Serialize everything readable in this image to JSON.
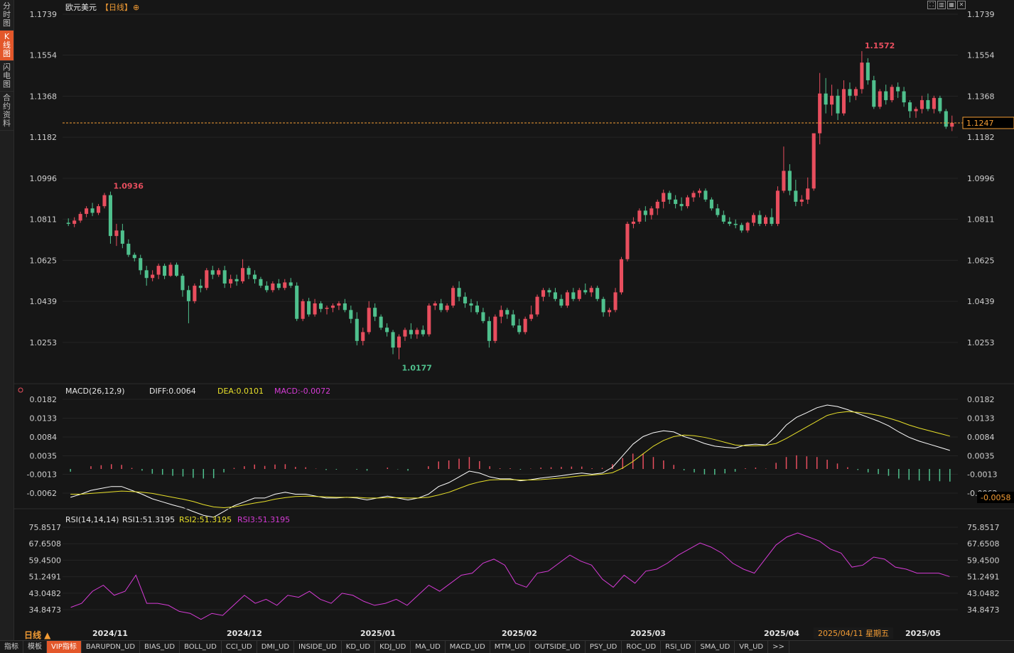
{
  "sidebar": [
    {
      "label": "分时图",
      "active": false
    },
    {
      "label": "K线图",
      "active": true
    },
    {
      "label": "闪电图",
      "active": false
    },
    {
      "label": "合约资料",
      "active": false
    }
  ],
  "header": {
    "symbol": "欧元美元",
    "period": "【日线】",
    "plus_icon": "⊕"
  },
  "toolbar_icons": [
    "fullscreen-icon",
    "layout-icon",
    "split-icon",
    "close-icon"
  ],
  "price_panel": {
    "ticks": [
      "1.1739",
      "1.1554",
      "1.1368",
      "1.1182",
      "1.0996",
      "1.0811",
      "1.0625",
      "1.0439",
      "1.0253"
    ],
    "current_price": "1.1247",
    "high_label": "1.1572",
    "high2_label": "1.0936",
    "low_label": "1.0177"
  },
  "macd_panel": {
    "title": "MACD(26,12,9)",
    "diff": "DIFF:0.0064",
    "dea": "DEA:0.0101",
    "macd": "MACD:-0.0072",
    "ticks": [
      "0.0182",
      "0.0133",
      "0.0084",
      "0.0035",
      "-0.0013",
      "-0.0062"
    ],
    "current": "-0.0058"
  },
  "rsi_panel": {
    "title": "RSI(14,14,14)",
    "rsi1": "RSI1:51.3195",
    "rsi2": "RSI2:51.3195",
    "rsi3": "RSI3:51.3195",
    "ticks": [
      "75.8517",
      "67.6508",
      "59.4500",
      "51.2491",
      "43.0482",
      "34.8473"
    ]
  },
  "x_axis": {
    "period_label": "日线 ▲",
    "labels": [
      "2024/11",
      "2024/12",
      "2025/01",
      "2025/02",
      "2025/03",
      "2025/04",
      "2025/05"
    ],
    "cursor_label": "2025/04/11 星期五"
  },
  "colors": {
    "up": "#e84e5e",
    "down": "#4fc08d",
    "diff": "#ffffff",
    "dea": "#e8e02a",
    "macd": "#d63bd6",
    "rsi": "#d63bd6",
    "current": "#f39c34"
  },
  "bottom_tabs": [
    "指标",
    "模板",
    "VIP指标",
    "BARUPDN_UD",
    "BIAS_UD",
    "BOLL_UD",
    "CCI_UD",
    "DMI_UD",
    "INSIDE_UD",
    "KD_UD",
    "KDJ_UD",
    "MA_UD",
    "MACD_UD",
    "MTM_UD",
    "OUTSIDE_UD",
    "PSY_UD",
    "ROC_UD",
    "RSI_UD",
    "SMA_UD",
    "VR_UD",
    ">>"
  ],
  "chart_data": {
    "type": "candlestick",
    "title": "欧元美元",
    "ylim": [
      1.012,
      1.18
    ],
    "ohlc": [
      [
        1.0795,
        1.0815,
        1.078,
        1.079
      ],
      [
        1.079,
        1.082,
        1.0775,
        1.0805
      ],
      [
        1.0805,
        1.0845,
        1.0795,
        1.0835
      ],
      [
        1.0835,
        1.087,
        1.082,
        1.086
      ],
      [
        1.086,
        1.0885,
        1.0825,
        1.084
      ],
      [
        1.084,
        1.088,
        1.083,
        1.087
      ],
      [
        1.087,
        1.093,
        1.086,
        1.092
      ],
      [
        1.092,
        1.0936,
        1.07,
        1.0735
      ],
      [
        1.0735,
        1.079,
        1.069,
        1.076
      ],
      [
        1.076,
        1.079,
        1.068,
        1.07
      ],
      [
        1.07,
        1.072,
        1.064,
        1.065
      ],
      [
        1.065,
        1.066,
        1.062,
        1.0635
      ],
      [
        1.0635,
        1.065,
        1.056,
        1.058
      ],
      [
        1.058,
        1.06,
        1.051,
        1.0545
      ],
      [
        1.0545,
        1.058,
        1.053,
        1.056
      ],
      [
        1.056,
        1.061,
        1.054,
        1.06
      ],
      [
        1.06,
        1.061,
        1.054,
        1.0555
      ],
      [
        1.0555,
        1.0615,
        1.055,
        1.0605
      ],
      [
        1.0605,
        1.0615,
        1.055,
        1.0555
      ],
      [
        1.0555,
        1.0565,
        1.046,
        1.049
      ],
      [
        1.049,
        1.051,
        1.034,
        1.044
      ],
      [
        1.044,
        1.052,
        1.043,
        1.051
      ],
      [
        1.051,
        1.054,
        1.048,
        1.05
      ],
      [
        1.05,
        1.059,
        1.049,
        1.058
      ],
      [
        1.058,
        1.06,
        1.054,
        1.056
      ],
      [
        1.056,
        1.059,
        1.055,
        1.058
      ],
      [
        1.058,
        1.06,
        1.05,
        1.052
      ],
      [
        1.052,
        1.056,
        1.05,
        1.054
      ],
      [
        1.054,
        1.056,
        1.051,
        1.053
      ],
      [
        1.053,
        1.063,
        1.052,
        1.059
      ],
      [
        1.059,
        1.06,
        1.054,
        1.056
      ],
      [
        1.056,
        1.058,
        1.052,
        1.054
      ],
      [
        1.054,
        1.055,
        1.05,
        1.051
      ],
      [
        1.051,
        1.053,
        1.048,
        1.049
      ],
      [
        1.049,
        1.053,
        1.048,
        1.052
      ],
      [
        1.052,
        1.054,
        1.049,
        1.05
      ],
      [
        1.05,
        1.054,
        1.049,
        1.0525
      ],
      [
        1.0525,
        1.0545,
        1.05,
        1.051
      ],
      [
        1.051,
        1.0525,
        1.035,
        1.036
      ],
      [
        1.036,
        1.045,
        1.035,
        1.044
      ],
      [
        1.044,
        1.0455,
        1.037,
        1.038
      ],
      [
        1.038,
        1.045,
        1.037,
        1.043
      ],
      [
        1.043,
        1.044,
        1.039,
        1.0405
      ],
      [
        1.0405,
        1.042,
        1.038,
        1.041
      ],
      [
        1.041,
        1.043,
        1.039,
        1.042
      ],
      [
        1.042,
        1.044,
        1.04,
        1.043
      ],
      [
        1.043,
        1.045,
        1.039,
        1.04
      ],
      [
        1.04,
        1.042,
        1.034,
        1.036
      ],
      [
        1.036,
        1.039,
        1.024,
        1.026
      ],
      [
        1.026,
        1.032,
        1.024,
        1.03
      ],
      [
        1.03,
        1.044,
        1.029,
        1.041
      ],
      [
        1.041,
        1.043,
        1.035,
        1.037
      ],
      [
        1.037,
        1.038,
        1.031,
        1.032
      ],
      [
        1.032,
        1.034,
        1.028,
        1.03
      ],
      [
        1.03,
        1.031,
        1.02,
        1.023
      ],
      [
        1.023,
        1.029,
        1.0177,
        1.028
      ],
      [
        1.028,
        1.032,
        1.026,
        1.031
      ],
      [
        1.031,
        1.034,
        1.027,
        1.029
      ],
      [
        1.029,
        1.032,
        1.027,
        1.031
      ],
      [
        1.031,
        1.033,
        1.028,
        1.029
      ],
      [
        1.029,
        1.043,
        1.028,
        1.042
      ],
      [
        1.042,
        1.044,
        1.04,
        1.043
      ],
      [
        1.043,
        1.045,
        1.039,
        1.04
      ],
      [
        1.04,
        1.043,
        1.039,
        1.042
      ],
      [
        1.042,
        1.051,
        1.041,
        1.05
      ],
      [
        1.05,
        1.053,
        1.044,
        1.046
      ],
      [
        1.046,
        1.048,
        1.041,
        1.043
      ],
      [
        1.043,
        1.045,
        1.039,
        1.042
      ],
      [
        1.042,
        1.044,
        1.038,
        1.039
      ],
      [
        1.039,
        1.041,
        1.034,
        1.035
      ],
      [
        1.035,
        1.037,
        1.023,
        1.026
      ],
      [
        1.026,
        1.038,
        1.025,
        1.037
      ],
      [
        1.037,
        1.042,
        1.034,
        1.04
      ],
      [
        1.04,
        1.041,
        1.036,
        1.038
      ],
      [
        1.038,
        1.04,
        1.032,
        1.033
      ],
      [
        1.033,
        1.036,
        1.029,
        1.03
      ],
      [
        1.03,
        1.037,
        1.029,
        1.036
      ],
      [
        1.036,
        1.042,
        1.035,
        1.038
      ],
      [
        1.038,
        1.047,
        1.037,
        1.046
      ],
      [
        1.046,
        1.05,
        1.044,
        1.049
      ],
      [
        1.049,
        1.05,
        1.046,
        1.048
      ],
      [
        1.048,
        1.05,
        1.044,
        1.045
      ],
      [
        1.045,
        1.047,
        1.041,
        1.042
      ],
      [
        1.042,
        1.049,
        1.041,
        1.048
      ],
      [
        1.048,
        1.05,
        1.044,
        1.045
      ],
      [
        1.045,
        1.05,
        1.044,
        1.049
      ],
      [
        1.049,
        1.052,
        1.047,
        1.048
      ],
      [
        1.048,
        1.051,
        1.046,
        1.05
      ],
      [
        1.05,
        1.051,
        1.044,
        1.045
      ],
      [
        1.045,
        1.046,
        1.037,
        1.039
      ],
      [
        1.039,
        1.041,
        1.037,
        1.04
      ],
      [
        1.04,
        1.05,
        1.039,
        1.048
      ],
      [
        1.048,
        1.064,
        1.047,
        1.063
      ],
      [
        1.063,
        1.08,
        1.062,
        1.079
      ],
      [
        1.079,
        1.082,
        1.077,
        1.08
      ],
      [
        1.08,
        1.086,
        1.079,
        1.085
      ],
      [
        1.085,
        1.087,
        1.08,
        1.083
      ],
      [
        1.083,
        1.087,
        1.081,
        1.086
      ],
      [
        1.086,
        1.09,
        1.083,
        1.089
      ],
      [
        1.089,
        1.0945,
        1.086,
        1.093
      ],
      [
        1.093,
        1.094,
        1.088,
        1.09
      ],
      [
        1.09,
        1.092,
        1.086,
        1.088
      ],
      [
        1.088,
        1.091,
        1.085,
        1.087
      ],
      [
        1.087,
        1.092,
        1.086,
        1.091
      ],
      [
        1.091,
        1.094,
        1.089,
        1.093
      ],
      [
        1.093,
        1.095,
        1.091,
        1.094
      ],
      [
        1.094,
        1.095,
        1.089,
        1.09
      ],
      [
        1.09,
        1.091,
        1.085,
        1.086
      ],
      [
        1.086,
        1.088,
        1.082,
        1.083
      ],
      [
        1.083,
        1.085,
        1.079,
        1.08
      ],
      [
        1.08,
        1.082,
        1.078,
        1.079
      ],
      [
        1.079,
        1.081,
        1.077,
        1.0785
      ],
      [
        1.0785,
        1.0795,
        1.075,
        1.076
      ],
      [
        1.076,
        1.08,
        1.075,
        1.0795
      ],
      [
        1.0795,
        1.084,
        1.078,
        1.083
      ],
      [
        1.083,
        1.085,
        1.078,
        1.079
      ],
      [
        1.079,
        1.083,
        1.078,
        1.082
      ],
      [
        1.082,
        1.086,
        1.078,
        1.079
      ],
      [
        1.079,
        1.096,
        1.078,
        1.094
      ],
      [
        1.094,
        1.114,
        1.093,
        1.103
      ],
      [
        1.103,
        1.106,
        1.092,
        1.094
      ],
      [
        1.094,
        1.099,
        1.087,
        1.089
      ],
      [
        1.089,
        1.092,
        1.087,
        1.09
      ],
      [
        1.09,
        1.1,
        1.088,
        1.095
      ],
      [
        1.095,
        1.114,
        1.094,
        1.12
      ],
      [
        1.12,
        1.1473,
        1.115,
        1.138
      ],
      [
        1.138,
        1.145,
        1.129,
        1.133
      ],
      [
        1.133,
        1.142,
        1.128,
        1.137
      ],
      [
        1.137,
        1.14,
        1.126,
        1.129
      ],
      [
        1.129,
        1.144,
        1.128,
        1.14
      ],
      [
        1.14,
        1.143,
        1.134,
        1.137
      ],
      [
        1.137,
        1.141,
        1.135,
        1.14
      ],
      [
        1.14,
        1.1572,
        1.138,
        1.152
      ],
      [
        1.152,
        1.154,
        1.142,
        1.144
      ],
      [
        1.144,
        1.146,
        1.131,
        1.132
      ],
      [
        1.132,
        1.14,
        1.131,
        1.139
      ],
      [
        1.139,
        1.142,
        1.133,
        1.135
      ],
      [
        1.135,
        1.142,
        1.134,
        1.141
      ],
      [
        1.141,
        1.143,
        1.136,
        1.139
      ],
      [
        1.139,
        1.141,
        1.132,
        1.134
      ],
      [
        1.134,
        1.135,
        1.127,
        1.13
      ],
      [
        1.13,
        1.132,
        1.127,
        1.131
      ],
      [
        1.131,
        1.137,
        1.129,
        1.135
      ],
      [
        1.135,
        1.138,
        1.13,
        1.131
      ],
      [
        1.131,
        1.137,
        1.129,
        1.136
      ],
      [
        1.136,
        1.137,
        1.129,
        1.13
      ],
      [
        1.13,
        1.131,
        1.122,
        1.123
      ],
      [
        1.123,
        1.128,
        1.121,
        1.1247
      ]
    ],
    "macd": {
      "diff": [
        -0.0058,
        -0.005,
        -0.004,
        -0.0035,
        -0.003,
        -0.003,
        -0.004,
        -0.005,
        -0.0062,
        -0.007,
        -0.0078,
        -0.0085,
        -0.0095,
        -0.0105,
        -0.011,
        -0.0095,
        -0.008,
        -0.007,
        -0.006,
        -0.006,
        -0.005,
        -0.0045,
        -0.005,
        -0.005,
        -0.0055,
        -0.006,
        -0.006,
        -0.0058,
        -0.006,
        -0.0065,
        -0.006,
        -0.0055,
        -0.006,
        -0.0065,
        -0.006,
        -0.005,
        -0.003,
        -0.002,
        -0.0005,
        0.001,
        0.0005,
        -0.0005,
        -0.001,
        -0.001,
        -0.0015,
        -0.0012,
        -0.0008,
        -0.0005,
        -0.0002,
        0.0002,
        0.0005,
        0.0002,
        0.0005,
        0.002,
        0.005,
        0.008,
        0.01,
        0.011,
        0.0115,
        0.0112,
        0.01,
        0.0092,
        0.0082,
        0.0075,
        0.0072,
        0.007,
        0.0078,
        0.008,
        0.0078,
        0.01,
        0.013,
        0.015,
        0.0162,
        0.0175,
        0.0182,
        0.0178,
        0.017,
        0.016,
        0.015,
        0.014,
        0.0128,
        0.0112,
        0.0098,
        0.0088,
        0.008,
        0.0072,
        0.0064
      ],
      "dea": [
        -0.005,
        -0.005,
        -0.0048,
        -0.0046,
        -0.0044,
        -0.0042,
        -0.0043,
        -0.0045,
        -0.0048,
        -0.0053,
        -0.0058,
        -0.0063,
        -0.0069,
        -0.0077,
        -0.0083,
        -0.0085,
        -0.0083,
        -0.0078,
        -0.0073,
        -0.0069,
        -0.0063,
        -0.0059,
        -0.0056,
        -0.0055,
        -0.0056,
        -0.0057,
        -0.0058,
        -0.0058,
        -0.0058,
        -0.006,
        -0.006,
        -0.0059,
        -0.0059,
        -0.006,
        -0.006,
        -0.0058,
        -0.0052,
        -0.0045,
        -0.0035,
        -0.0025,
        -0.0018,
        -0.0013,
        -0.0012,
        -0.0012,
        -0.0013,
        -0.0013,
        -0.0012,
        -0.001,
        -0.0008,
        -0.0005,
        -0.0002,
        0.0,
        0.0002,
        0.0006,
        0.0018,
        0.0035,
        0.0055,
        0.0075,
        0.009,
        0.01,
        0.0104,
        0.0102,
        0.0098,
        0.0092,
        0.0085,
        0.0078,
        0.0076,
        0.0076,
        0.0077,
        0.0082,
        0.0095,
        0.011,
        0.0125,
        0.014,
        0.0155,
        0.0162,
        0.0165,
        0.0163,
        0.016,
        0.0155,
        0.0148,
        0.014,
        0.013,
        0.0122,
        0.0115,
        0.0108,
        0.0101
      ]
    },
    "rsi": [
      41,
      45,
      48,
      44,
      46,
      52,
      38,
      40,
      36,
      35,
      31,
      30,
      32,
      29,
      35,
      38,
      40,
      37,
      45,
      43,
      45,
      44,
      42,
      46,
      48,
      46,
      42,
      44,
      45,
      41,
      39,
      42,
      46,
      48,
      45,
      51,
      54,
      55,
      58,
      60,
      56,
      48,
      47,
      53,
      55,
      58,
      62,
      58,
      57,
      50,
      45,
      52,
      48,
      53,
      55,
      58,
      62,
      64,
      66,
      65,
      63,
      58,
      54,
      52,
      60,
      66,
      70,
      72,
      70,
      68,
      64,
      62,
      55,
      56,
      60,
      59,
      55,
      54,
      52,
      52,
      53,
      49
    ],
    "rsi_plot": [
      36,
      38,
      44,
      47,
      42,
      44,
      52,
      38,
      38,
      37,
      34,
      33,
      30,
      33,
      32,
      37,
      42,
      38,
      40,
      37,
      42,
      41,
      44,
      40,
      38,
      43,
      42,
      39,
      37,
      38,
      40,
      37,
      42,
      47,
      44,
      48,
      52,
      53,
      58,
      60,
      57,
      48,
      46,
      53,
      54,
      58,
      62,
      59,
      57,
      50,
      46,
      52,
      48,
      54,
      55,
      58,
      62,
      65,
      68,
      66,
      63,
      58,
      55,
      53,
      60,
      67,
      71,
      73,
      71,
      69,
      65,
      63,
      56,
      57,
      61,
      60,
      56,
      55,
      53,
      53,
      53,
      51.3
    ]
  }
}
